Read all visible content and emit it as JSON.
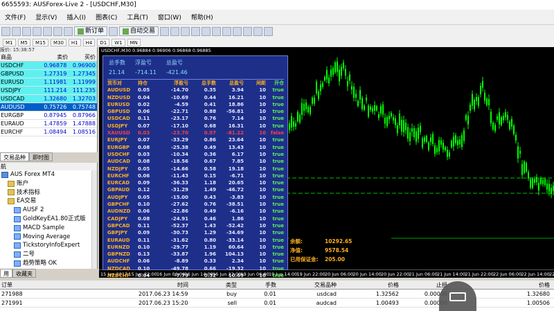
{
  "window": {
    "title": "6655593: AUSForex-Live 2 - [USDCHF,M30]"
  },
  "menu": [
    "文件(F)",
    "显示(V)",
    "插入(I)",
    "图表(C)",
    "工具(T)",
    "窗口(W)",
    "帮助(H)"
  ],
  "toolbar": {
    "new_order": "新订单",
    "auto_trade": "自动交易"
  },
  "timeframes": [
    "M1",
    "M5",
    "M15",
    "M30",
    "H1",
    "H4",
    "D1",
    "W1",
    "MN"
  ],
  "market_watch": {
    "header": "报价: 15:38:57",
    "columns": [
      "商品",
      "卖价",
      "买价"
    ],
    "rows": [
      {
        "symbol": "USDCHF",
        "bid": "0.96878",
        "ask": "0.96900"
      },
      {
        "symbol": "GBPUSD",
        "bid": "1.27319",
        "ask": "1.27345"
      },
      {
        "symbol": "EURUSD",
        "bid": "1.11981",
        "ask": "1.11999"
      },
      {
        "symbol": "USDJPY",
        "bid": "111.214",
        "ask": "111.235"
      },
      {
        "symbol": "USDCAD",
        "bid": "1.32680",
        "ask": "1.32703"
      },
      {
        "symbol": "AUDUSD",
        "bid": "0.75726",
        "ask": "0.75748"
      },
      {
        "symbol": "EURGBP",
        "bid": "0.87945",
        "ask": "0.87966"
      },
      {
        "symbol": "EURAUD",
        "bid": "1.47859",
        "ask": "1.47888"
      },
      {
        "symbol": "EURCHF",
        "bid": "1.08494",
        "ask": "1.08516"
      }
    ],
    "tabs": [
      "交易品种",
      "即时图"
    ]
  },
  "navigator": {
    "header": "航",
    "items": [
      {
        "label": "AUS Forex MT4",
        "indent": 0
      },
      {
        "label": "账户",
        "indent": 1
      },
      {
        "label": "技术指标",
        "indent": 1
      },
      {
        "label": "EA交易",
        "indent": 1
      },
      {
        "label": "AUSF 2",
        "indent": 2
      },
      {
        "label": "GoldKeyEA1.80正式版",
        "indent": 2
      },
      {
        "label": "MACD Sample",
        "indent": 2
      },
      {
        "label": "Moving Average",
        "indent": 2
      },
      {
        "label": "TickstoryInfoExpert",
        "indent": 2
      },
      {
        "label": "二号",
        "indent": 2
      },
      {
        "label": "趋势策略 OK",
        "indent": 2
      }
    ],
    "tabs": [
      "用",
      "收藏夹"
    ]
  },
  "chart": {
    "title": "USDCHF,M30  0.96884 0.96906 0.96868 0.96885",
    "x_labels": [
      "15 Jun 2017",
      "15 Jun 22:00",
      "16 Jun 06:00",
      "16 Jun 14:00",
      "16 Jun 22:00",
      "19 Jun 06:00",
      "19 Jun 14:00",
      "19 Jun 22:00",
      "20 Jun 06:00",
      "20 Jun 14:00",
      "20 Jun 22:00",
      "21 Jun 06:00",
      "21 Jun 14:00",
      "21 Jun 22:00",
      "22 Jun 06:00",
      "22 Jun 14:00",
      "22 Jun 22:05"
    ]
  },
  "ea_panel": {
    "summary": [
      {
        "label": "总手数",
        "value": "21.14"
      },
      {
        "label": "浮盈亏",
        "value": "-714.11"
      },
      {
        "label": "总盈亏",
        "value": "-421.46"
      }
    ],
    "columns": [
      "货币对",
      "持仓",
      "浮盈亏",
      "总手数",
      "总盈亏",
      "间距",
      "开仓"
    ],
    "rows": [
      [
        "AUDUSD",
        "0.05",
        "-14.70",
        "0.35",
        "3.94",
        "10",
        "true"
      ],
      [
        "NZDUSD",
        "0.04",
        "-10.69",
        "0.44",
        "16.21",
        "10",
        "true"
      ],
      [
        "EURUSD",
        "0.02",
        "-4.59",
        "0.41",
        "18.86",
        "10",
        "true"
      ],
      [
        "GBPUSD",
        "0.06",
        "-22.71",
        "0.88",
        "-56.81",
        "10",
        "true"
      ],
      [
        "USDCAD",
        "0.11",
        "-23.17",
        "0.76",
        "7.14",
        "10",
        "true"
      ],
      [
        "USDJPY",
        "0.07",
        "-17.10",
        "0.68",
        "16.31",
        "10",
        "true"
      ],
      [
        "XAUUSD",
        "0.03",
        "-23.70",
        "0.97",
        "-81.22",
        "10",
        "false"
      ],
      [
        "EURJPY",
        "0.07",
        "-33.29",
        "0.86",
        "23.64",
        "10",
        "true"
      ],
      [
        "EURGBP",
        "0.08",
        "-25.38",
        "0.49",
        "13.43",
        "10",
        "true"
      ],
      [
        "USDCHF",
        "0.03",
        "-10.34",
        "0.36",
        "6.17",
        "10",
        "true"
      ],
      [
        "AUDCAD",
        "0.08",
        "-18.56",
        "0.67",
        "7.85",
        "10",
        "true"
      ],
      [
        "NZDJPY",
        "0.05",
        "-14.66",
        "0.58",
        "19.18",
        "10",
        "true"
      ],
      [
        "EURCHF",
        "0.06",
        "-11.43",
        "0.15",
        "-6.71",
        "10",
        "true"
      ],
      [
        "EURCAD",
        "0.09",
        "-36.33",
        "1.18",
        "20.65",
        "10",
        "true"
      ],
      [
        "GBPAUD",
        "0.12",
        "-31.29",
        "1.49",
        "-46.72",
        "10",
        "true"
      ],
      [
        "AUDJPY",
        "0.05",
        "-15.00",
        "0.43",
        "-3.83",
        "10",
        "true"
      ],
      [
        "GBPCHF",
        "0.10",
        "-27.62",
        "0.76",
        "-38.51",
        "10",
        "true"
      ],
      [
        "AUDNZD",
        "0.06",
        "-22.86",
        "0.49",
        "-6.16",
        "10",
        "true"
      ],
      [
        "CADJPY",
        "0.08",
        "-24.91",
        "0.46",
        "1.86",
        "10",
        "true"
      ],
      [
        "GBPCAD",
        "0.11",
        "-52.37",
        "1.43",
        "-52.42",
        "10",
        "true"
      ],
      [
        "GBPJPY",
        "0.09",
        "-30.73",
        "1.29",
        "-34.69",
        "10",
        "true"
      ],
      [
        "EURAUD",
        "0.11",
        "-31.62",
        "0.80",
        "-33.14",
        "10",
        "true"
      ],
      [
        "EURNZD",
        "0.10",
        "-29.77",
        "1.19",
        "60.64",
        "10",
        "true"
      ],
      [
        "GBPNZD",
        "0.13",
        "-33.87",
        "1.96",
        "104.13",
        "10",
        "true"
      ],
      [
        "AUDCHF",
        "0.06",
        "-8.89",
        "0.33",
        "2.34",
        "10",
        "true"
      ],
      [
        "NZDCAD",
        "0.10",
        "-49.78",
        "0.66",
        "-19.32",
        "10",
        "true"
      ],
      [
        "NZDCHF",
        "0.04",
        "-7.79",
        "0.32",
        "10.69",
        "10",
        "true"
      ]
    ]
  },
  "account": [
    {
      "label": "余额:",
      "value": "10292.65"
    },
    {
      "label": "净值:",
      "value": "9578.54"
    },
    {
      "label": "已用保证金:",
      "value": "205.00"
    }
  ],
  "terminal": {
    "columns": [
      "订单",
      "时间",
      "类型",
      "手数",
      "交易品种",
      "价格",
      "止损",
      "",
      "价格"
    ],
    "rows": [
      [
        "271988",
        "2017.06.23 14:59:34",
        "buy",
        "0.01",
        "usdcad",
        "1.32562",
        "0.00000",
        "",
        "1.32680"
      ],
      [
        "271991",
        "2017.06.23 15:20:13",
        "sell",
        "0.01",
        "audcad",
        "1.00493",
        "0.00000",
        "",
        "1.00506"
      ]
    ]
  },
  "colors": {
    "chart_bg": "#000000",
    "candle": "#00ff00",
    "panel_bg": "#1e2f8a",
    "accent_orange": "#ffb020",
    "selected_row": "#0060c8",
    "highlight_row": "#5ef0f0"
  }
}
